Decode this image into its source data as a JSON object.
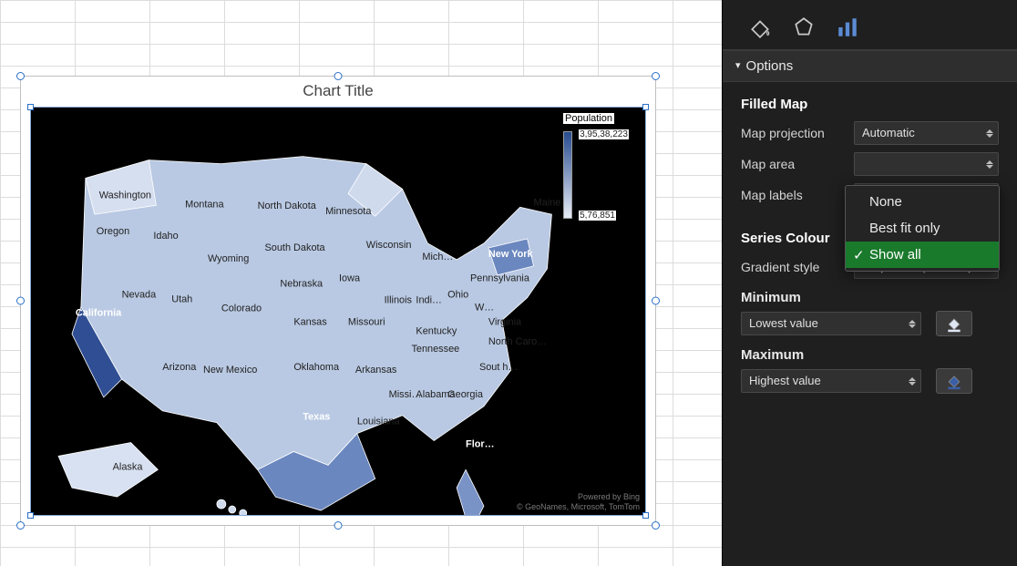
{
  "chart": {
    "title": "Chart Title",
    "legend_title": "Population",
    "legend_max": "3,95,38,223",
    "legend_min": "5,76,851",
    "attribution_line1": "Powered by Bing",
    "attribution_line2": "© GeoNames, Microsoft, TomTom"
  },
  "chart_data": {
    "type": "filled-map",
    "region": "United States",
    "value_field": "Population",
    "scale": {
      "min": 576851,
      "max": 39538223,
      "style": "sequential-2-colour"
    },
    "labels": [
      "Washington",
      "Oregon",
      "Idaho",
      "Montana",
      "North Dakota",
      "Minnesota",
      "Wisconsin",
      "Maine",
      "Wyoming",
      "South Dakota",
      "Iowa",
      "Mich…",
      "New York",
      "Nevada",
      "Utah",
      "Colorado",
      "Nebraska",
      "Kansas",
      "Missouri",
      "Illinois",
      "Indi…",
      "Ohio",
      "Pennsylvania",
      "W…",
      "Virginia",
      "California",
      "Arizona",
      "New Mexico",
      "Oklahoma",
      "Arkansas",
      "Tennessee",
      "Kentucky",
      "North Caro…",
      "Sout h…",
      "Texas",
      "Louisiana",
      "Missi…",
      "Alabama",
      "Georgia",
      "Flor…",
      "Alaska"
    ]
  },
  "pane": {
    "options_header": "Options",
    "filled_map_header": "Filled Map",
    "map_projection_label": "Map projection",
    "map_projection_value": "Automatic",
    "map_area_label": "Map area",
    "map_area_value": "",
    "map_labels_label": "Map labels",
    "map_labels_value": "",
    "series_colour_header": "Series Colour",
    "gradient_style_label": "Gradient style",
    "gradient_style_value": "Sequential (2-colour)",
    "minimum_header": "Minimum",
    "minimum_value": "Lowest value",
    "maximum_header": "Maximum",
    "maximum_value": "Highest value"
  },
  "flyout": {
    "opt_none": "None",
    "opt_best_fit": "Best fit only",
    "opt_show_all": "Show all"
  },
  "colors": {
    "pane_bg": "#1f1f1f",
    "selected_green": "#1a7a2c",
    "map_dark": "#274b8f",
    "map_light": "#e6ecf5"
  }
}
